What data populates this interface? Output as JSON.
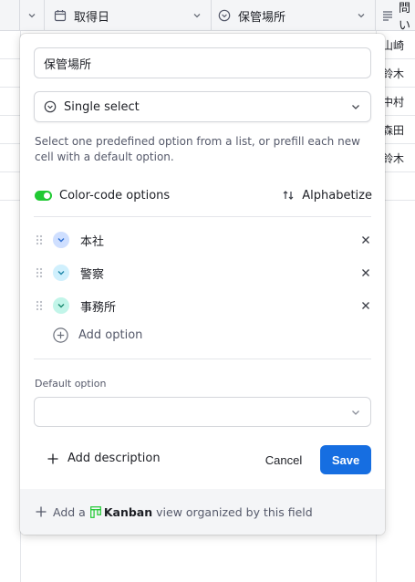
{
  "grid": {
    "columns": [
      {
        "label": "取得日",
        "icon": "calendar-icon"
      },
      {
        "label": "保管場所",
        "icon": "single-select-icon"
      },
      {
        "label": "問い",
        "icon": "long-text-icon"
      }
    ],
    "row_values": [
      "山崎",
      "鈴木",
      "中村",
      "森田",
      "鈴木"
    ]
  },
  "modal": {
    "field_name": "保管場所",
    "field_type": "Single select",
    "description": "Select one predefined option from a list, or prefill each new cell with a default option.",
    "color_code_label": "Color-code options",
    "color_code_enabled": true,
    "alphabetize_label": "Alphabetize",
    "options": [
      {
        "label": "本社",
        "color": "#cfdfff",
        "chevron_color": "#2d6fd2"
      },
      {
        "label": "警察",
        "color": "#d0f0fd",
        "chevron_color": "#1f87a8"
      },
      {
        "label": "事務所",
        "color": "#c2f5e9",
        "chevron_color": "#1c8a70"
      }
    ],
    "add_option_label": "Add option",
    "default_option_label": "Default option",
    "default_option_value": "",
    "add_description_label": "Add description",
    "cancel_label": "Cancel",
    "save_label": "Save",
    "footer": {
      "prefix": "Add a",
      "kanban": "Kanban",
      "suffix": "view organized by this field"
    }
  },
  "colors": {
    "accent": "#166ee1",
    "toggle_on": "#20c933",
    "kanban_icon": "#20c933"
  }
}
